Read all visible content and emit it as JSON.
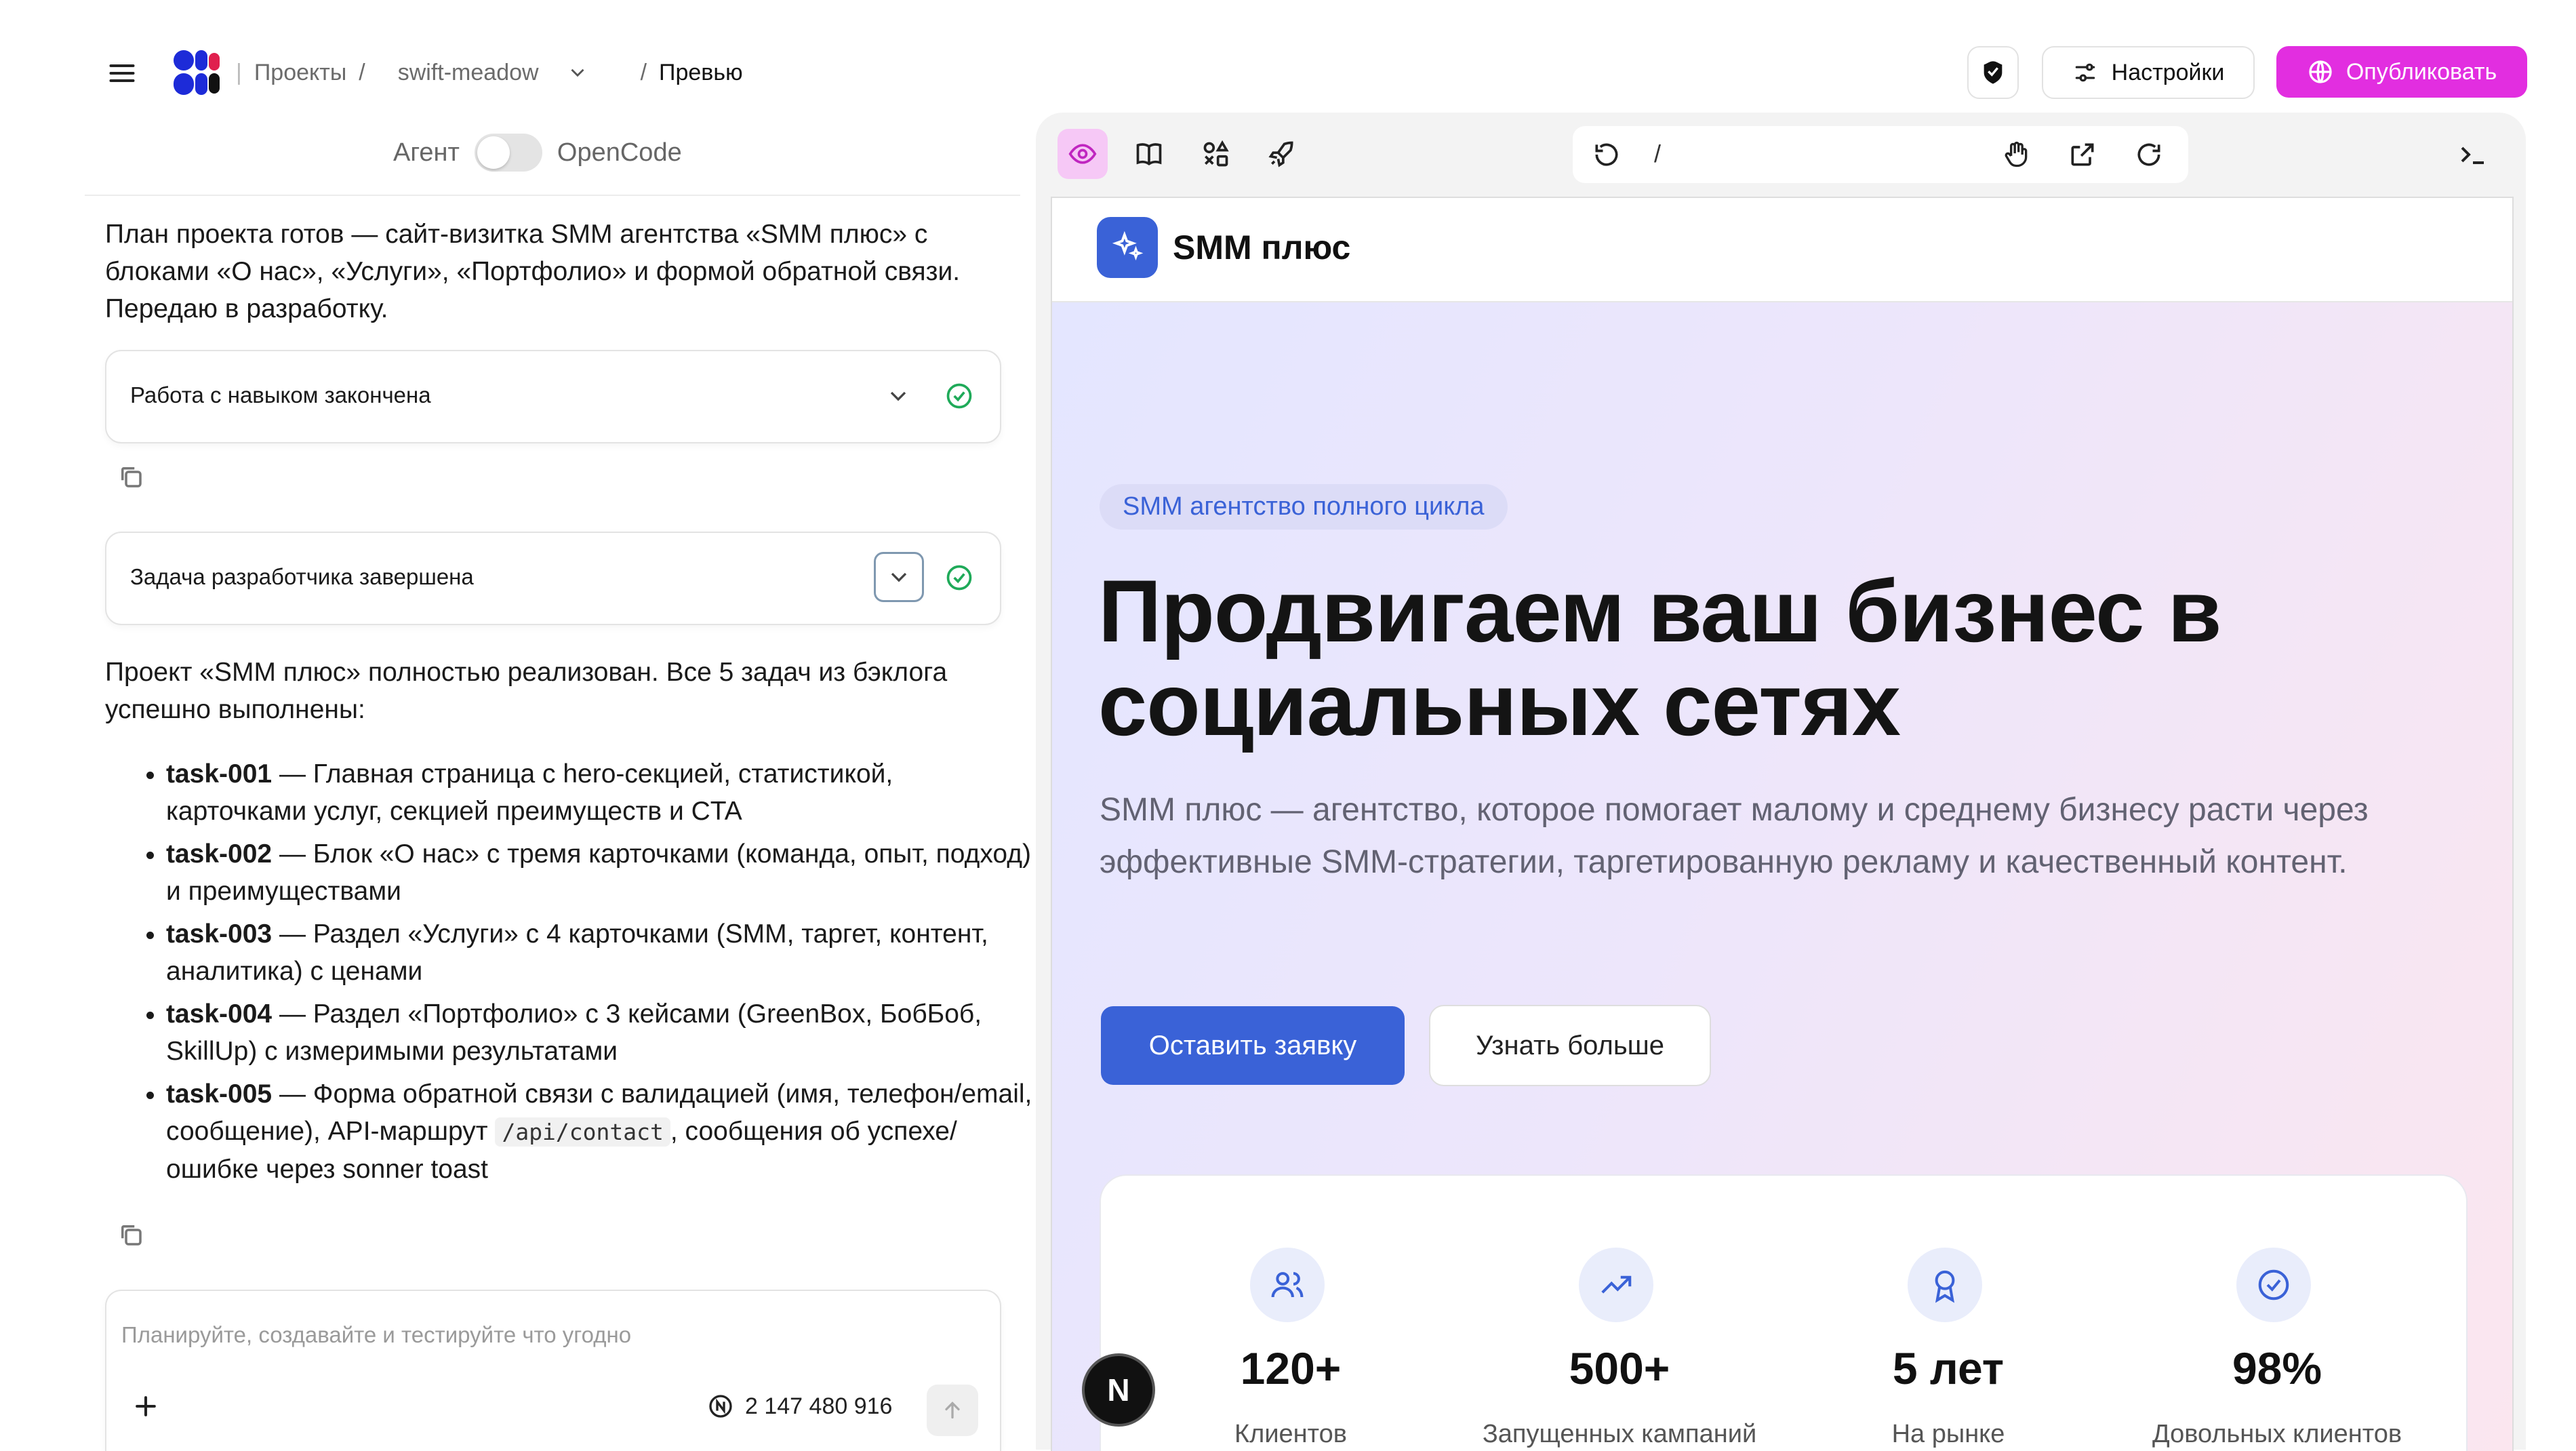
{
  "header": {
    "breadcrumb_projects": "Проекты",
    "sep1": "/",
    "project_name": "swift-meadow",
    "sep2": "/",
    "current_page": "Превью",
    "settings_label": "Настройки",
    "publish_label": "Опубликовать"
  },
  "mode_switch": {
    "left": "Агент",
    "right": "OpenCode"
  },
  "chat": {
    "message1": "План проекта готов — сайт-визитка SMM агентства «SMM плюс» с блоками «О нас», «Услуги», «Портфолио» и формой обратной связи. Передаю в разработку.",
    "card1_label": "Работа с навыком закончена",
    "card2_label": "Задача разработчика завершена",
    "message2": "Проект «SMM плюс» полностью реализован. Все 5 задач из бэклога успешно выполнены:",
    "tasks": [
      {
        "id": "task-001",
        "text": " — Главная страница с hero-секцией, статистикой, карточками услуг, секцией преимуществ и CTA"
      },
      {
        "id": "task-002",
        "text": " — Блок «О нас» с тремя карточками (команда, опыт, подход) и преимуществами"
      },
      {
        "id": "task-003",
        "text": " — Раздел «Услуги» с 4 карточками (SMM, таргет, контент, аналитика) с ценами"
      },
      {
        "id": "task-004",
        "text": " — Раздел «Портфолио» с 3 кейсами (GreenBox, БобБоб, SkillUp) с измеримыми результатами"
      },
      {
        "id": "task-005",
        "text_before": " — Форма обратной связи с валидацией (имя, телефон/email, сообщение), API-маршрут ",
        "code": "/api/contact",
        "text_after": ", сообщения об успехе/ошибке через sonner toast"
      }
    ],
    "input_placeholder": "Планируйте, создавайте и тестируйте что угодно",
    "token_count": "2 147 480 916"
  },
  "preview": {
    "address": "/",
    "site_name": "SMM плюс",
    "badge": "SMM агентство полного цикла",
    "headline_line1": "Продвигаем ваш бизнес в",
    "headline_line2": "социальных сетях",
    "description": "SMM плюс — агентство, которое помогает малому и среднему бизнесу расти через эффективные SMM-стратегии, таргетированную рекламу и качественный контент.",
    "cta_primary": "Оставить заявку",
    "cta_secondary": "Узнать больше",
    "stats": [
      {
        "value": "120+",
        "label": "Клиентов",
        "icon": "users-icon"
      },
      {
        "value": "500+",
        "label": "Запущенных кампаний",
        "icon": "trending-up-icon"
      },
      {
        "value": "5 лет",
        "label": "На рынке",
        "icon": "award-icon"
      },
      {
        "value": "98%",
        "label": "Довольных клиентов",
        "icon": "check-circle-icon"
      }
    ],
    "next_badge": "N"
  },
  "colors": {
    "accent_publish": "#e22ee0",
    "primary_blue": "#3a62d7",
    "success_green": "#1faa59"
  }
}
